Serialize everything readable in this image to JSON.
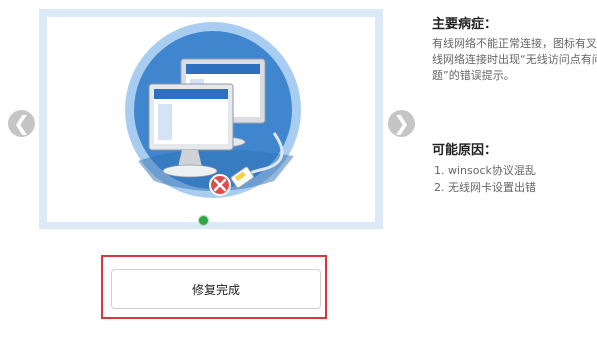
{
  "carousel": {
    "prev_glyph": "❮",
    "next_glyph": "❯",
    "active_slide": 1,
    "illustration_icon": "network-computers-disconnected-icon"
  },
  "symptoms": {
    "title": "主要病症：",
    "text": "有线网络不能正常连接，图标有叉；无线网络连接时出现“无线访问点有问题”的错误提示。"
  },
  "causes": {
    "title": "可能原因：",
    "items": [
      "1. winsock协议混乱",
      "2. 无线网卡设置出错"
    ]
  },
  "action": {
    "button_label": "修复完成",
    "highlight_color": "#d9363e"
  },
  "colors": {
    "circle_outer": "#a9cdf1",
    "circle_inner": "#3f86cf",
    "error_red": "#e04b4b",
    "dot_active": "#2ea641"
  }
}
